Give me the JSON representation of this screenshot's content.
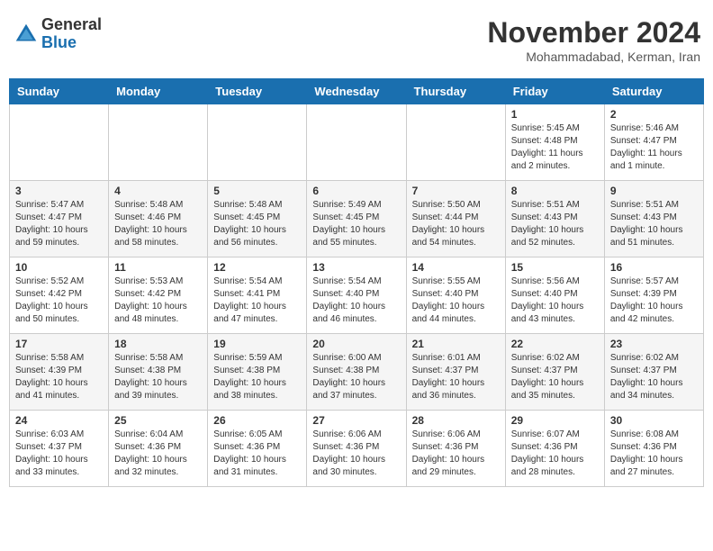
{
  "logo": {
    "general": "General",
    "blue": "Blue"
  },
  "title": "November 2024",
  "location": "Mohammadabad, Kerman, Iran",
  "days_of_week": [
    "Sunday",
    "Monday",
    "Tuesday",
    "Wednesday",
    "Thursday",
    "Friday",
    "Saturday"
  ],
  "weeks": [
    [
      {
        "day": "",
        "info": ""
      },
      {
        "day": "",
        "info": ""
      },
      {
        "day": "",
        "info": ""
      },
      {
        "day": "",
        "info": ""
      },
      {
        "day": "",
        "info": ""
      },
      {
        "day": "1",
        "info": "Sunrise: 5:45 AM\nSunset: 4:48 PM\nDaylight: 11 hours and 2 minutes."
      },
      {
        "day": "2",
        "info": "Sunrise: 5:46 AM\nSunset: 4:47 PM\nDaylight: 11 hours and 1 minute."
      }
    ],
    [
      {
        "day": "3",
        "info": "Sunrise: 5:47 AM\nSunset: 4:47 PM\nDaylight: 10 hours and 59 minutes."
      },
      {
        "day": "4",
        "info": "Sunrise: 5:48 AM\nSunset: 4:46 PM\nDaylight: 10 hours and 58 minutes."
      },
      {
        "day": "5",
        "info": "Sunrise: 5:48 AM\nSunset: 4:45 PM\nDaylight: 10 hours and 56 minutes."
      },
      {
        "day": "6",
        "info": "Sunrise: 5:49 AM\nSunset: 4:45 PM\nDaylight: 10 hours and 55 minutes."
      },
      {
        "day": "7",
        "info": "Sunrise: 5:50 AM\nSunset: 4:44 PM\nDaylight: 10 hours and 54 minutes."
      },
      {
        "day": "8",
        "info": "Sunrise: 5:51 AM\nSunset: 4:43 PM\nDaylight: 10 hours and 52 minutes."
      },
      {
        "day": "9",
        "info": "Sunrise: 5:51 AM\nSunset: 4:43 PM\nDaylight: 10 hours and 51 minutes."
      }
    ],
    [
      {
        "day": "10",
        "info": "Sunrise: 5:52 AM\nSunset: 4:42 PM\nDaylight: 10 hours and 50 minutes."
      },
      {
        "day": "11",
        "info": "Sunrise: 5:53 AM\nSunset: 4:42 PM\nDaylight: 10 hours and 48 minutes."
      },
      {
        "day": "12",
        "info": "Sunrise: 5:54 AM\nSunset: 4:41 PM\nDaylight: 10 hours and 47 minutes."
      },
      {
        "day": "13",
        "info": "Sunrise: 5:54 AM\nSunset: 4:40 PM\nDaylight: 10 hours and 46 minutes."
      },
      {
        "day": "14",
        "info": "Sunrise: 5:55 AM\nSunset: 4:40 PM\nDaylight: 10 hours and 44 minutes."
      },
      {
        "day": "15",
        "info": "Sunrise: 5:56 AM\nSunset: 4:40 PM\nDaylight: 10 hours and 43 minutes."
      },
      {
        "day": "16",
        "info": "Sunrise: 5:57 AM\nSunset: 4:39 PM\nDaylight: 10 hours and 42 minutes."
      }
    ],
    [
      {
        "day": "17",
        "info": "Sunrise: 5:58 AM\nSunset: 4:39 PM\nDaylight: 10 hours and 41 minutes."
      },
      {
        "day": "18",
        "info": "Sunrise: 5:58 AM\nSunset: 4:38 PM\nDaylight: 10 hours and 39 minutes."
      },
      {
        "day": "19",
        "info": "Sunrise: 5:59 AM\nSunset: 4:38 PM\nDaylight: 10 hours and 38 minutes."
      },
      {
        "day": "20",
        "info": "Sunrise: 6:00 AM\nSunset: 4:38 PM\nDaylight: 10 hours and 37 minutes."
      },
      {
        "day": "21",
        "info": "Sunrise: 6:01 AM\nSunset: 4:37 PM\nDaylight: 10 hours and 36 minutes."
      },
      {
        "day": "22",
        "info": "Sunrise: 6:02 AM\nSunset: 4:37 PM\nDaylight: 10 hours and 35 minutes."
      },
      {
        "day": "23",
        "info": "Sunrise: 6:02 AM\nSunset: 4:37 PM\nDaylight: 10 hours and 34 minutes."
      }
    ],
    [
      {
        "day": "24",
        "info": "Sunrise: 6:03 AM\nSunset: 4:37 PM\nDaylight: 10 hours and 33 minutes."
      },
      {
        "day": "25",
        "info": "Sunrise: 6:04 AM\nSunset: 4:36 PM\nDaylight: 10 hours and 32 minutes."
      },
      {
        "day": "26",
        "info": "Sunrise: 6:05 AM\nSunset: 4:36 PM\nDaylight: 10 hours and 31 minutes."
      },
      {
        "day": "27",
        "info": "Sunrise: 6:06 AM\nSunset: 4:36 PM\nDaylight: 10 hours and 30 minutes."
      },
      {
        "day": "28",
        "info": "Sunrise: 6:06 AM\nSunset: 4:36 PM\nDaylight: 10 hours and 29 minutes."
      },
      {
        "day": "29",
        "info": "Sunrise: 6:07 AM\nSunset: 4:36 PM\nDaylight: 10 hours and 28 minutes."
      },
      {
        "day": "30",
        "info": "Sunrise: 6:08 AM\nSunset: 4:36 PM\nDaylight: 10 hours and 27 minutes."
      }
    ]
  ]
}
